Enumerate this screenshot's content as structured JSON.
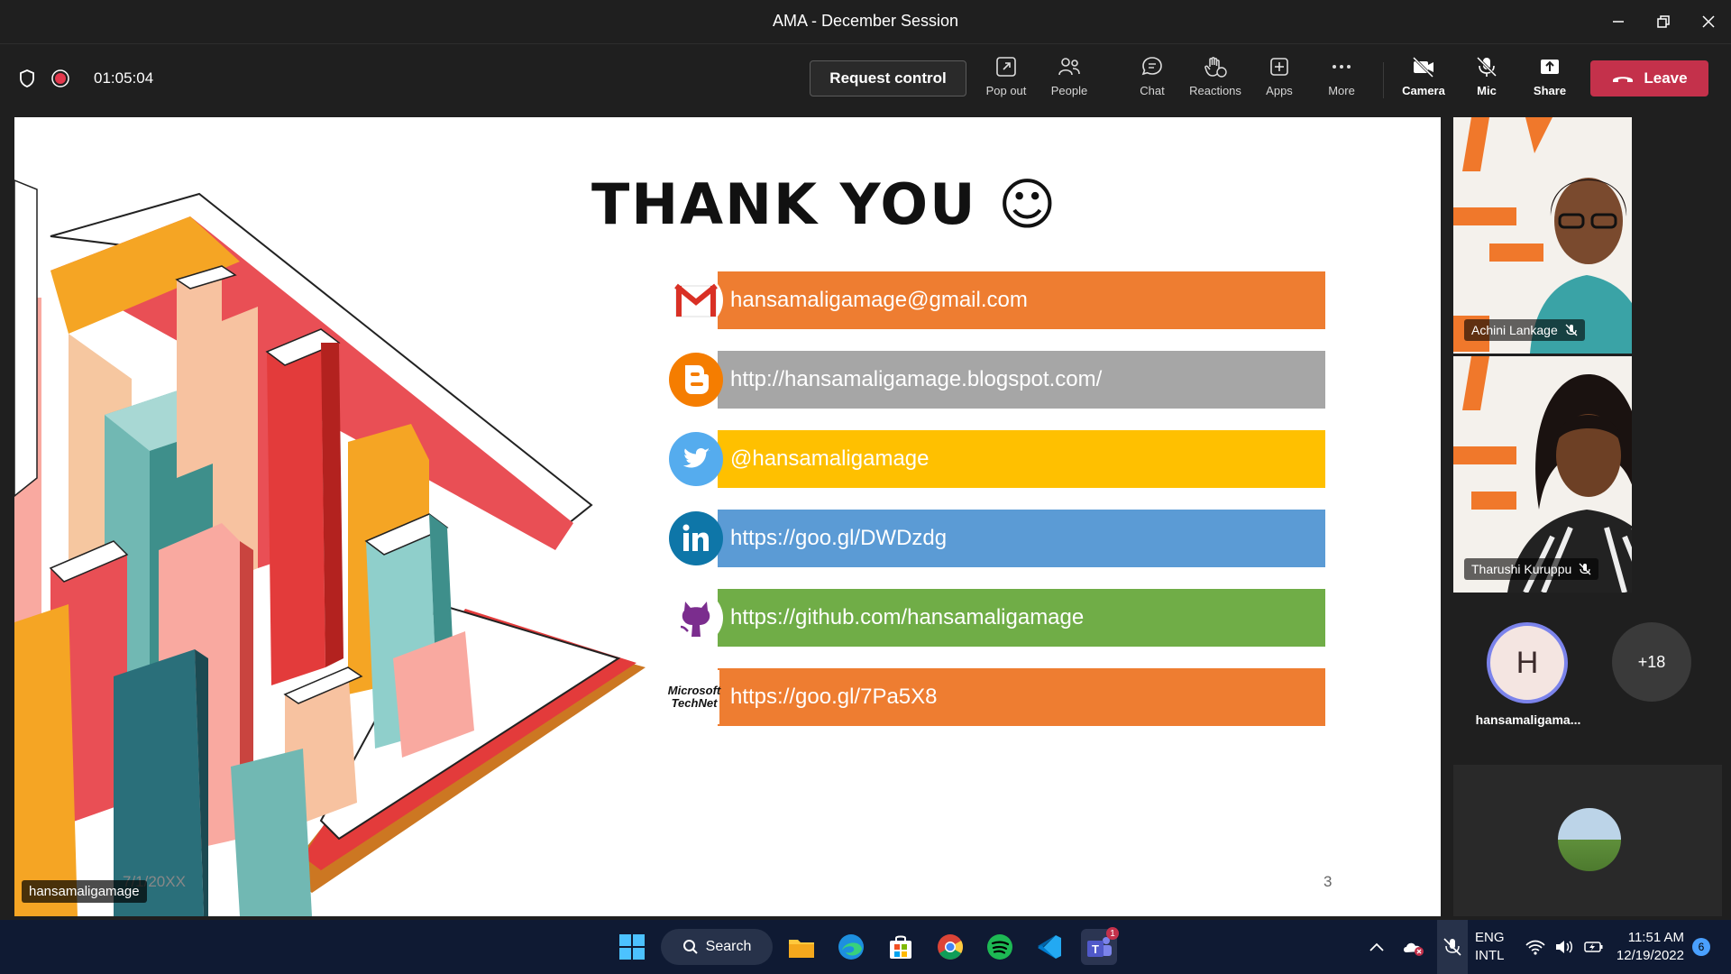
{
  "window": {
    "title": "AMA - December Session"
  },
  "toolbar": {
    "timer": "01:05:04",
    "request_control": "Request control",
    "buttons": {
      "popout": "Pop out",
      "people": "People",
      "chat": "Chat",
      "reactions": "Reactions",
      "apps": "Apps",
      "more": "More",
      "camera": "Camera",
      "mic": "Mic",
      "share": "Share"
    },
    "leave": "Leave"
  },
  "slide": {
    "title": "THANK YOU ☺",
    "rows": [
      {
        "icon": "gmail-icon",
        "text": "hansamaligamage@gmail.com",
        "color": "#ee7d31"
      },
      {
        "icon": "blogger-icon",
        "text": "http://hansamaligamage.blogspot.com/",
        "color": "#a6a6a6"
      },
      {
        "icon": "twitter-icon",
        "text": "@hansamaligamage",
        "color": "#ffc000"
      },
      {
        "icon": "linkedin-icon",
        "text": "https://goo.gl/DWDzdg",
        "color": "#5b9bd5"
      },
      {
        "icon": "github-icon",
        "text": "https://github.com/hansamaligamage",
        "color": "#70ad47"
      },
      {
        "icon": "technet-icon",
        "text": "https://goo.gl/7Pa5X8",
        "color": "#ee7d31"
      }
    ],
    "technet_logo_text": "Microsoft TechNet",
    "date": "7/1/20XX",
    "page_number": "3",
    "presenter": "hansamaligamage"
  },
  "participants": {
    "tiles": [
      {
        "name": "Achini Lankage"
      },
      {
        "name": "Tharushi Kuruppu"
      }
    ],
    "avatar_initial": "H",
    "avatar_name": "hansamaligama...",
    "more_count": "+18"
  },
  "taskbar": {
    "search": "Search",
    "lang_line1": "ENG",
    "lang_line2": "INTL",
    "time": "11:51 AM",
    "date": "12/19/2022",
    "notification_count": "6",
    "teams_badge": "1"
  }
}
